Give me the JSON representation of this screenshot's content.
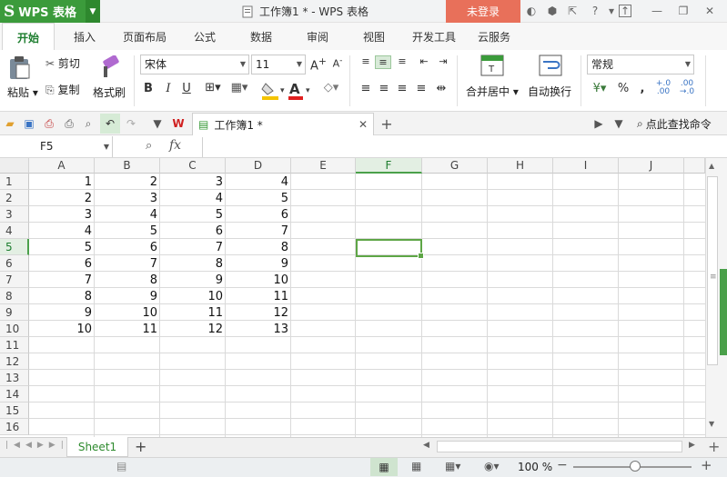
{
  "app": {
    "name": "WPS 表格",
    "title": "工作簿1 * - WPS 表格",
    "login": "未登录"
  },
  "tabs": [
    "开始",
    "插入",
    "页面布局",
    "公式",
    "数据",
    "审阅",
    "视图",
    "开发工具",
    "云服务"
  ],
  "ribbon": {
    "paste": "粘贴",
    "cut": "剪切",
    "copy": "复制",
    "format_painter": "格式刷",
    "font_name": "宋体",
    "font_size": "11",
    "merge_center": "合并居中",
    "wrap_text": "自动换行",
    "number_format": "常规"
  },
  "quickbar": {
    "doc_tab": "工作簿1 *",
    "search": "点此查找命令"
  },
  "formula_bar": {
    "name_box": "F5",
    "fx": "fx",
    "formula": ""
  },
  "grid": {
    "columns": [
      "A",
      "B",
      "C",
      "D",
      "E",
      "F",
      "G",
      "H",
      "I",
      "J"
    ],
    "selected_column": "F",
    "rows": [
      "1",
      "2",
      "3",
      "4",
      "5",
      "6",
      "7",
      "8",
      "9",
      "10",
      "11",
      "12",
      "13",
      "14",
      "15",
      "16"
    ],
    "selected_row": "5",
    "cells": [
      [
        1,
        2,
        3,
        4
      ],
      [
        2,
        3,
        4,
        5
      ],
      [
        3,
        4,
        5,
        6
      ],
      [
        4,
        5,
        6,
        7
      ],
      [
        5,
        6,
        7,
        8
      ],
      [
        6,
        7,
        8,
        9
      ],
      [
        7,
        8,
        9,
        10
      ],
      [
        8,
        9,
        10,
        11
      ],
      [
        9,
        10,
        11,
        12
      ],
      [
        10,
        11,
        12,
        13
      ]
    ],
    "selected_cell": "F5"
  },
  "sheets": [
    "Sheet1"
  ],
  "status": {
    "zoom": "100 %"
  },
  "colors": {
    "accent": "#3b9b3b",
    "login": "#e8705a",
    "selection": "#5ea646"
  }
}
